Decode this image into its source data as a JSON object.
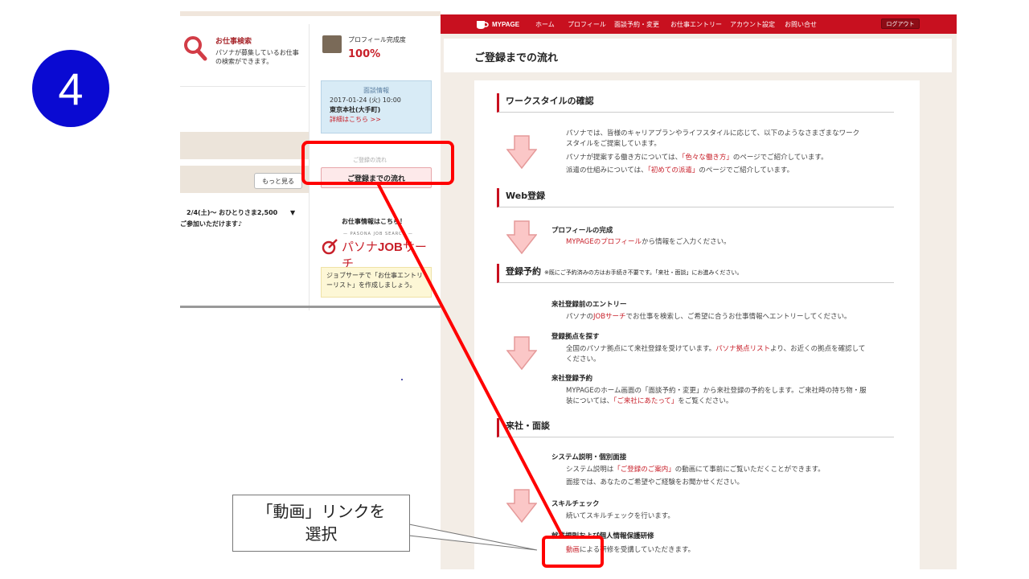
{
  "step_number": "4",
  "left_page": {
    "search": {
      "title": "お仕事検索",
      "desc": "パソナが募集しているお仕事の検索ができます。"
    },
    "profile": {
      "label": "プロフィール完成度",
      "percent": "100%"
    },
    "interview": {
      "heading": "面談情報",
      "date": "2017-01-24 (火) 10:00",
      "place": "東京本社(大手町)",
      "more": "詳細はこちら >>"
    },
    "faded_label": "ご登録の流れ",
    "flow_button": "ご登録までの流れ",
    "more_button": "もっと見る",
    "event_lines": [
      "　2/4(土)～ おひとりさま2,500",
      "ご参加いただけます♪"
    ],
    "jobinfo_title": "お仕事情報はこちら！",
    "jobsearch_small": "— PASONA JOB SEARCH —",
    "jobsearch_name_a": "パソナ",
    "jobsearch_name_b": "JOB",
    "jobsearch_name_c": "サーチ",
    "entry_note": "ジョブサーチで「お仕事エントリーリスト」を作成しましょう。"
  },
  "mypage": {
    "logo": "MYPAGE",
    "nav": [
      "ホーム",
      "プロフィール",
      "面談予約・変更",
      "お仕事エントリー",
      "アカウント設定",
      "お問い合せ"
    ],
    "logout": "ログアウト",
    "page_title": "ご登録までの流れ",
    "sections": {
      "workstyle": {
        "title": "ワークスタイルの確認",
        "lines": [
          "パソナでは、皆様のキャリアプランやライフスタイルに応じて、以下のようなさまざまなワーク",
          "スタイルをご提案しています。"
        ],
        "line2_a": "パソナが提案する働き方については、",
        "line2_link": "「色々な働き方」",
        "line2_b": "のページでご紹介しています。",
        "line3_a": "派遣の仕組みについては、",
        "line3_link": "「初めての派遣」",
        "line3_b": "のページでご紹介しています。"
      },
      "web": {
        "title": "Web登録",
        "sub": "プロフィールの完成",
        "line_link": "MYPAGEのプロフィール",
        "line_b": "から情報をご入力ください。"
      },
      "reserve": {
        "title": "登録予約",
        "note": "※既にご予約済みの方はお手続き不要です。「来社・面談」にお進みください。",
        "sub1": "来社登録前のエントリー",
        "sub1_a": "パソナの",
        "sub1_link": "JOBサーチ",
        "sub1_b": "でお仕事を検索し、ご希望に合うお仕事情報へエントリーしてください。",
        "sub2": "登録拠点を探す",
        "sub2_a": "全国のパソナ拠点にて来社登録を受けています。",
        "sub2_link": "パソナ拠点リスト",
        "sub2_b": "より、お近くの拠点を確認して",
        "sub2_c": "ください。",
        "sub3": "来社登録予約",
        "sub3_line1": "MYPAGEのホーム画面の「面談予約・変更」から来社登録の予約をします。ご来社時の持ち物・服",
        "sub3_a": "装については、",
        "sub3_link": "「ご来社にあたって」",
        "sub3_b": "をご覧ください。"
      },
      "visit": {
        "title": "来社・面談",
        "sub1": "システム説明・個別面接",
        "sub1_a": "システム説明は",
        "sub1_link": "「ご登録のご案内」",
        "sub1_b": "の動画にて事前にご覧いただくことができます。",
        "sub1_line2": "面接では、あなたのご希望やご経験をお聞かせください。",
        "sub2": "スキルチェック",
        "sub2_line": "続いてスキルチェックを行います。",
        "sub3": "就業規則および個人情報保護研修",
        "sub3_link": "動画",
        "sub3_b": "による研修を受講していただきます。"
      }
    }
  },
  "annotation": {
    "callout_line1": "「動画」リンクを",
    "callout_line2": "選択"
  },
  "colors": {
    "brand_red": "#c8101f",
    "highlight_red": "#ff0000",
    "badge_blue": "#0a0ad2"
  }
}
